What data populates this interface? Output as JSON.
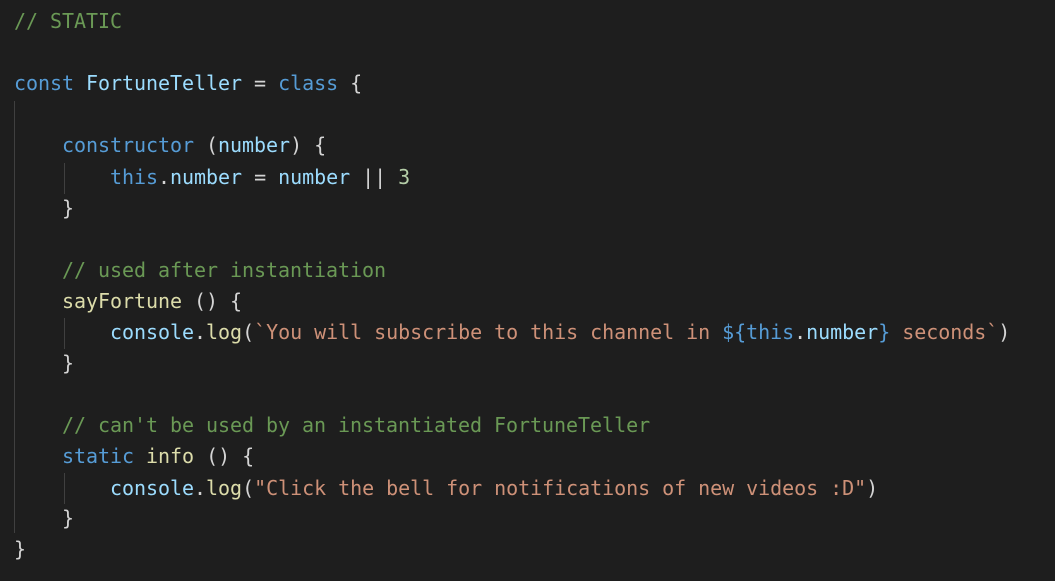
{
  "code": {
    "l1": {
      "comment": "// STATIC"
    },
    "l3": {
      "kw_const": "const",
      "name": "FortuneTeller",
      "eq": " = ",
      "kw_class": "class",
      "brace": " {"
    },
    "l5": {
      "kw_constructor": "constructor",
      "open": " (",
      "param": "number",
      "close": ") {"
    },
    "l6": {
      "kw_this": "this",
      "dot": ".",
      "prop": "number",
      "eq": " = ",
      "rhs": "number",
      "or": " || ",
      "num": "3"
    },
    "l7": {
      "brace": "}"
    },
    "l9": {
      "comment": "// used after instantiation"
    },
    "l10": {
      "fn": "sayFortune",
      "rest": " () {"
    },
    "l11": {
      "obj": "console",
      "dot": ".",
      "fn": "log",
      "open": "(",
      "str1": "`You will subscribe to this channel in ",
      "interp_open": "${",
      "this": "this",
      "dot2": ".",
      "prop": "number",
      "interp_close": "}",
      "str2": " seconds`",
      "close": ")"
    },
    "l12": {
      "brace": "}"
    },
    "l14": {
      "comment": "// can't be used by an instantiated FortuneTeller"
    },
    "l15": {
      "kw_static": "static",
      "space": " ",
      "fn": "info",
      "rest": " () {"
    },
    "l16": {
      "obj": "console",
      "dot": ".",
      "fn": "log",
      "open": "(",
      "str": "\"Click the bell for notifications of new videos :D\"",
      "close": ")"
    },
    "l17": {
      "brace": "}"
    },
    "l18": {
      "brace": "}"
    }
  },
  "colors": {
    "background": "#1e1e1e",
    "comment": "#6a9955",
    "keyword": "#569cd6",
    "variable": "#9cdcfe",
    "function": "#dcdcaa",
    "string": "#ce9178",
    "number": "#b5cea8"
  }
}
